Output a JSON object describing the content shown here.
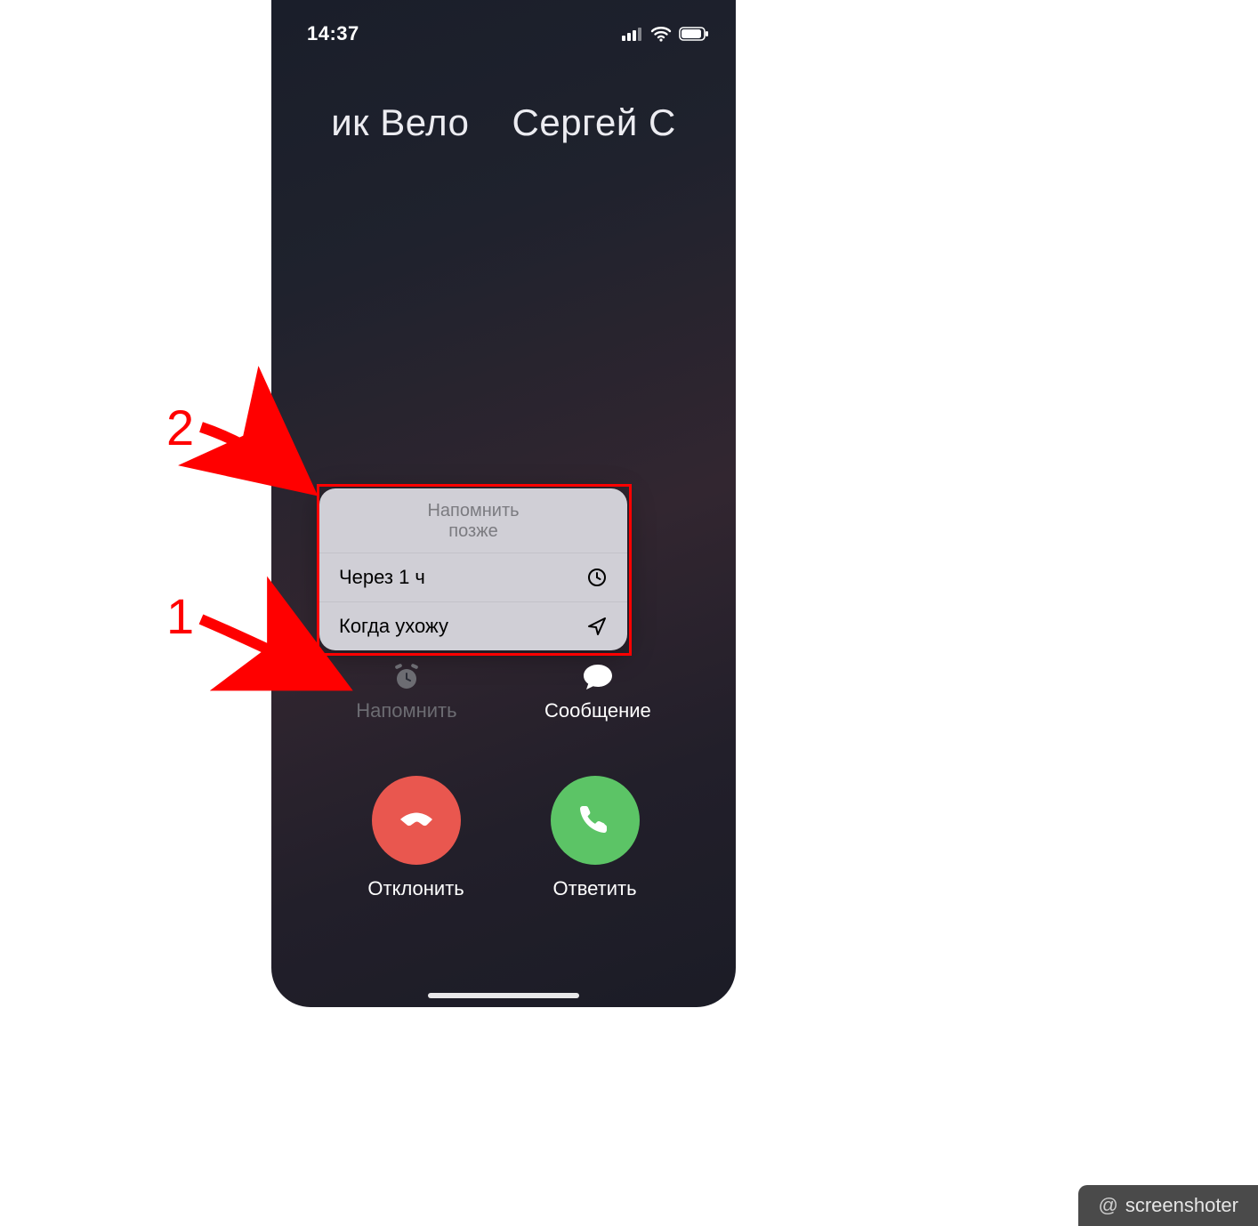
{
  "status": {
    "time": "14:37"
  },
  "caller": {
    "left": "ик Вело",
    "right": "Сергей С"
  },
  "popup": {
    "title_line1": "Напомнить",
    "title_line2": "позже",
    "items": [
      {
        "label": "Через 1 ч",
        "icon": "clock-icon"
      },
      {
        "label": "Когда ухожу",
        "icon": "navigate-icon"
      }
    ]
  },
  "secondary": {
    "remind": {
      "label": "Напомнить"
    },
    "message": {
      "label": "Сообщение"
    }
  },
  "primary": {
    "decline": {
      "label": "Отклонить"
    },
    "answer": {
      "label": "Ответить"
    }
  },
  "annotations": {
    "num1": "1",
    "num2": "2"
  },
  "colors": {
    "decline": "#e9574f",
    "answer": "#5cc466",
    "highlight": "#ff0000"
  },
  "watermark": {
    "at": "@",
    "text": "screenshoter"
  }
}
